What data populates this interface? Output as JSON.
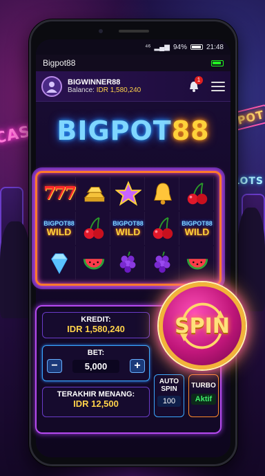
{
  "status_bar": {
    "signal": "⁴⁶",
    "battery_percent": "94%",
    "time": "21:48"
  },
  "app": {
    "title": "Bigpot88"
  },
  "user": {
    "name": "BIGWINNER88",
    "balance_label": "Balance:",
    "balance_value": "IDR 1,580,240",
    "notification_count": "1"
  },
  "logo": {
    "part1": "BIGPOT",
    "part2": "88"
  },
  "background": {
    "sign_left": "CASINO",
    "sign_right": "JACKPOT",
    "sign_slots": "SLOTS"
  },
  "reels": [
    [
      "seven",
      "gold-bars",
      "star",
      "bell",
      "cherries"
    ],
    [
      "wild",
      "cherries",
      "wild",
      "cherries",
      "wild"
    ],
    [
      "diamond",
      "watermelon",
      "grapes",
      "grapes",
      "watermelon"
    ]
  ],
  "wild_symbol": {
    "line1": "BIGPOT88",
    "line2": "WILD"
  },
  "controls": {
    "kredit_label": "KREDIT:",
    "kredit_value": "IDR 1,580,240",
    "bet_label": "BET:",
    "bet_value": "5,000",
    "minus": "−",
    "plus": "+",
    "last_win_label": "TERAKHIR MENANG:",
    "last_win_value": "IDR 12,500",
    "auto_label_1": "AUTO",
    "auto_label_2": "SPIN",
    "auto_value": "100",
    "turbo_label": "TURBO",
    "turbo_value": "Aktif",
    "spin_label": "SPIN"
  },
  "colors": {
    "accent_gold": "#ffd23a",
    "accent_blue": "#7fd6ff",
    "spin_pink": "#c0167a",
    "turbo_green": "#3ef06a"
  }
}
